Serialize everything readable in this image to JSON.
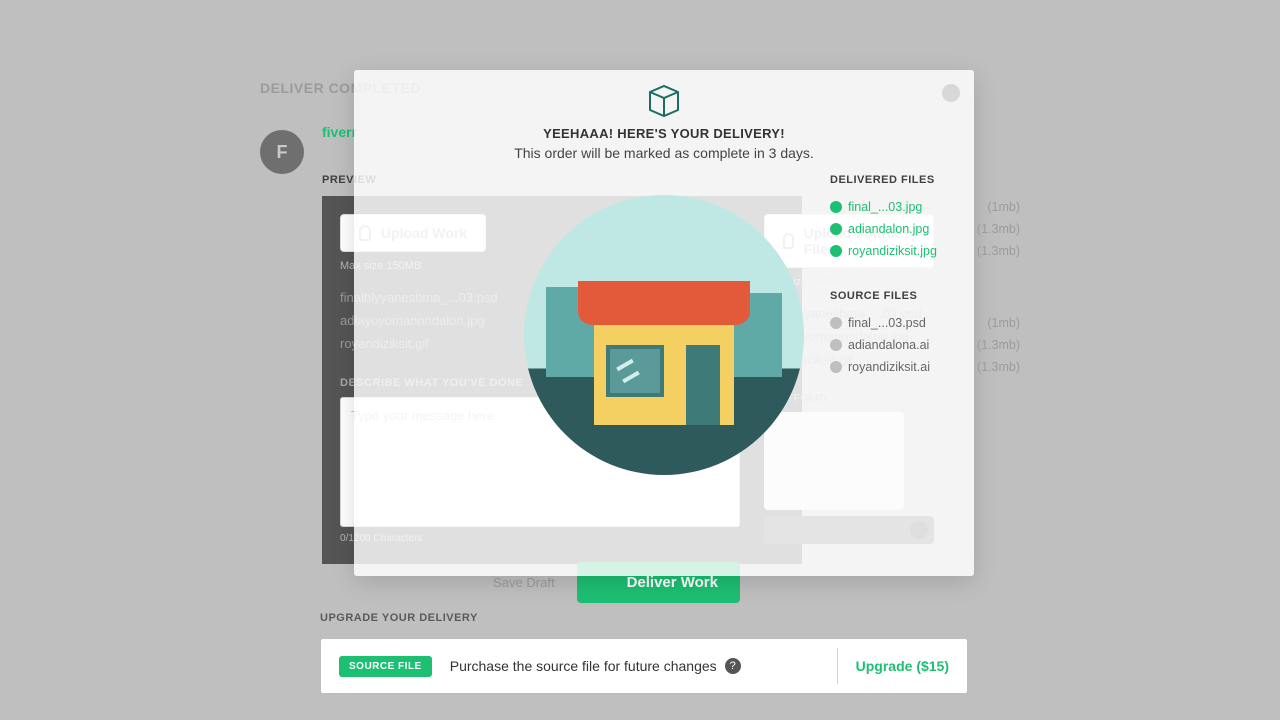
{
  "header": {
    "title": "DELIVER COMPLETED"
  },
  "seller": {
    "name": "fiverr",
    "avatar_letter": "F"
  },
  "labels": {
    "preview": "PREVIEW",
    "delivered_files": "DELIVERED FILES",
    "source_files": "SOURCE FILES",
    "upload_work": "Upload Work",
    "upload_source": "Upload Source Files",
    "max_size": "Max size 150MB",
    "describe": "DESCRIBE WHAT YOU'VE DONE",
    "placeholder": "Type your message here",
    "char_note": "0/1200 Characters",
    "portfolio": "PORTFOLIO",
    "save_draft": "Save Draft",
    "deliver_work": "Deliver Work"
  },
  "bg_files_left": [
    {
      "name": "finalblyyaneshma_...03.psd"
    },
    {
      "name": "adiayoyomannndalon.jpg"
    },
    {
      "name": "royandiziksit.gif"
    }
  ],
  "bg_files_right": [
    {
      "name": "finalblyyaneshma_...03.psd"
    },
    {
      "name": "adiayoyomannndalon.jpg"
    },
    {
      "name": "royandiziksit.gif"
    }
  ],
  "delivered_files": [
    {
      "name": "final_...03.jpg",
      "size": "(1mb)"
    },
    {
      "name": "adiandalon.jpg",
      "size": "(1.3mb)"
    },
    {
      "name": "royandiziksit.jpg",
      "size": "(1.3mb)"
    }
  ],
  "source_files": [
    {
      "name": "final_...03.psd",
      "size": "(1mb)"
    },
    {
      "name": "adiandalona.ai",
      "size": "(1.3mb)"
    },
    {
      "name": "royandiziksit.ai",
      "size": "(1.3mb)"
    }
  ],
  "overlay": {
    "title": "YEEHAAA! HERE'S YOUR DELIVERY!",
    "subtitle": "This order will be marked as complete in 3 days."
  },
  "upgrade": {
    "label": "UPGRADE YOUR DELIVERY",
    "badge": "SOURCE FILE",
    "text": "Purchase the source file for future changes",
    "button": "Upgrade ($15)"
  }
}
